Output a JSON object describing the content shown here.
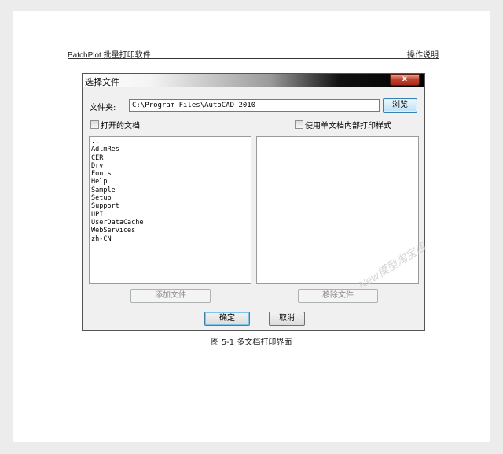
{
  "doc": {
    "header_left": "BatchPlot 批量打印软件",
    "header_right": "操作说明",
    "caption": "图 5-1  多文档打印界面",
    "watermark": "New模型淘宝店"
  },
  "dialog": {
    "title": "选择文件",
    "close_label": "x",
    "folder_label": "文件夹:",
    "folder_value": "C:\\Program Files\\AutoCAD 2010",
    "browse_label": "浏览",
    "open_docs_label": "打开的文档",
    "single_doc_style_label": "使用单文档内部打印样式",
    "file_list": [
      "..",
      "AdlmRes",
      "CER",
      "Drv",
      "Fonts",
      "Help",
      "Sample",
      "Setup",
      "Support",
      "UPI",
      "UserDataCache",
      "WebServices",
      "zh-CN"
    ],
    "add_file_label": "添加文件",
    "remove_file_label": "移除文件",
    "ok_label": "确定",
    "cancel_label": "取消"
  }
}
